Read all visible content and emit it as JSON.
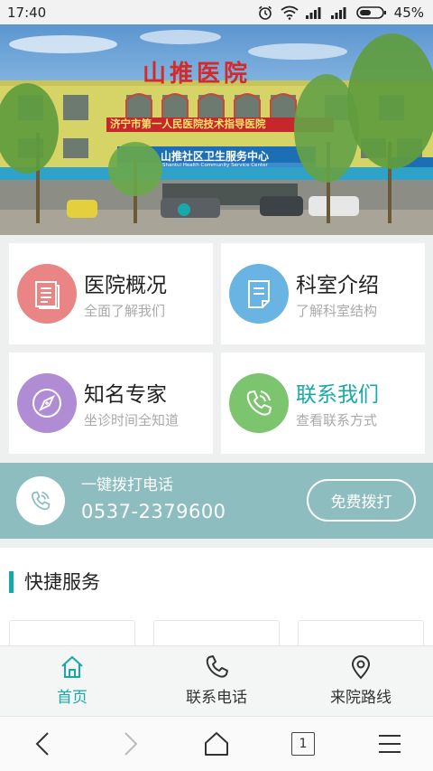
{
  "status": {
    "time": "17:40",
    "battery": "45%"
  },
  "banner": {
    "sign_main": "山推医院",
    "sign_red": "济宁市第一人民医院技术指导医院",
    "sign_blue": "山推社区卫生服务中心",
    "sign_blue_en": "Shantui Health Community Service Center",
    "slide_active": 1
  },
  "cards": [
    {
      "title": "医院概况",
      "sub": "全面了解我们",
      "icon": "document-icon",
      "color": "#e98585",
      "title_color": "#222222"
    },
    {
      "title": "科室介绍",
      "sub": "了解科室结构",
      "icon": "note-icon",
      "color": "#6ab4e3",
      "title_color": "#222222"
    },
    {
      "title": "知名专家",
      "sub": "坐诊时间全知道",
      "icon": "compass-icon",
      "color": "#b08cd4",
      "title_color": "#222222"
    },
    {
      "title": "联系我们",
      "sub": "查看联系方式",
      "icon": "phone-ringing-icon",
      "color": "#7cc46e",
      "title_color": "#19a8a8"
    }
  ],
  "call": {
    "label": "一键拨打电话",
    "number": "0537-2379600",
    "button": "免费拨打",
    "bg": "#8dbdbf"
  },
  "quick": {
    "title": "快捷服务"
  },
  "tabs": [
    {
      "label": "首页",
      "icon": "home-icon",
      "active": true
    },
    {
      "label": "联系电话",
      "icon": "phone-icon",
      "active": false
    },
    {
      "label": "来院路线",
      "icon": "location-pin-icon",
      "active": false
    }
  ],
  "browser": {
    "tabs_count": "1"
  },
  "colors": {
    "accent": "#19a8a8"
  }
}
